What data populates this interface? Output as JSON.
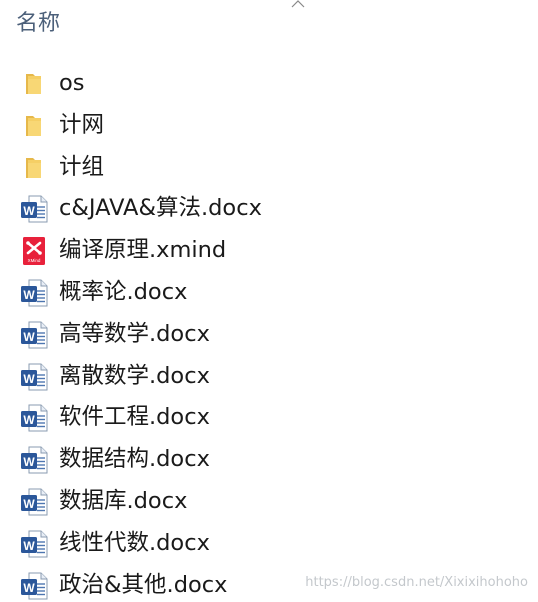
{
  "header": {
    "column_title": "名称"
  },
  "files": [
    {
      "name": "os",
      "type": "folder",
      "icon": "folder-icon"
    },
    {
      "name": "计网",
      "type": "folder",
      "icon": "folder-icon"
    },
    {
      "name": "计组",
      "type": "folder",
      "icon": "folder-icon"
    },
    {
      "name": "c&JAVA&算法.docx",
      "type": "word",
      "icon": "word-document-icon"
    },
    {
      "name": "编译原理.xmind",
      "type": "xmind",
      "icon": "xmind-file-icon"
    },
    {
      "name": "概率论.docx",
      "type": "word",
      "icon": "word-document-icon"
    },
    {
      "name": "高等数学.docx",
      "type": "word",
      "icon": "word-document-icon"
    },
    {
      "name": "离散数学.docx",
      "type": "word",
      "icon": "word-document-icon"
    },
    {
      "name": "软件工程.docx",
      "type": "word",
      "icon": "word-document-icon"
    },
    {
      "name": "数据结构.docx",
      "type": "word",
      "icon": "word-document-icon"
    },
    {
      "name": "数据库.docx",
      "type": "word",
      "icon": "word-document-icon"
    },
    {
      "name": "线性代数.docx",
      "type": "word",
      "icon": "word-document-icon"
    },
    {
      "name": "政治&其他.docx",
      "type": "word",
      "icon": "word-document-icon"
    }
  ],
  "watermark": "https://blog.csdn.net/Xixixihohoho",
  "colors": {
    "folder": "#f8d775",
    "word": "#2b579a",
    "xmind": "#e8213b",
    "header_text": "#4c607a"
  }
}
